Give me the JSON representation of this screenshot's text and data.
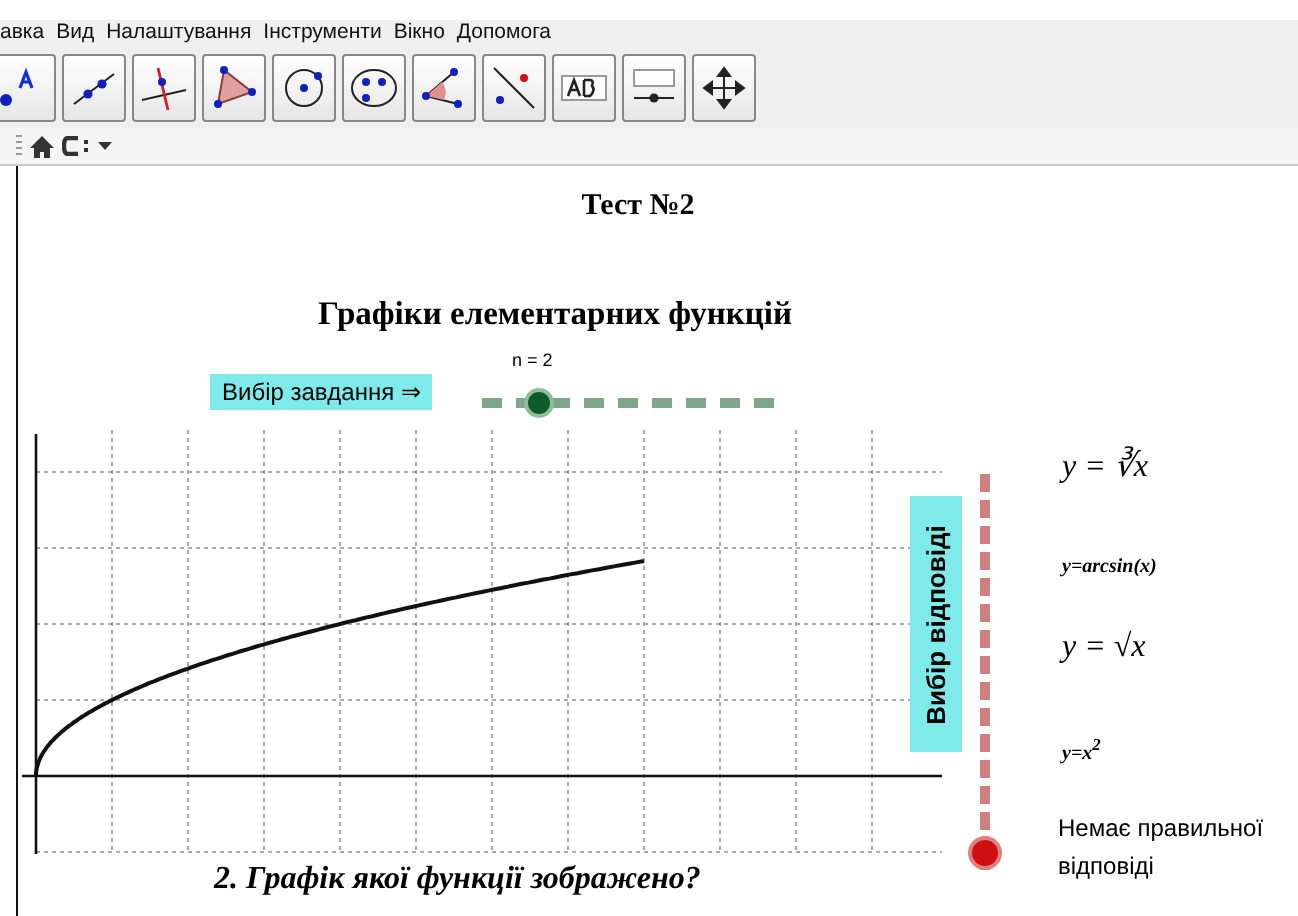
{
  "menu": [
    "авка",
    "Вид",
    "Налаштування",
    "Інструменти",
    "Вікно",
    "Допомога"
  ],
  "title": "Тест №2",
  "heading": "Графіки елементарних функцій",
  "task_button": "Вибір завдання ⇒",
  "task_slider": {
    "label": "n = 2",
    "level": 0.16
  },
  "answer_button": "Вибір відповіді",
  "answer_slider": {
    "level": 0
  },
  "answers": [
    {
      "kind": "math",
      "text": "y = ∛x"
    },
    {
      "kind": "small",
      "text": "y=arcsin(x)"
    },
    {
      "kind": "math",
      "text": "y = √x"
    },
    {
      "kind": "small",
      "text": "y=x$^{2}$"
    },
    {
      "kind": "plain",
      "text": "Немає правильної відповіді"
    }
  ],
  "question": "2. Графік якої функції зображено?"
}
